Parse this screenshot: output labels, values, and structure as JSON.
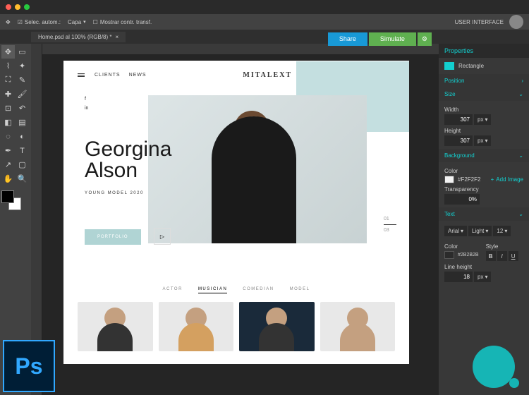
{
  "options": {
    "select_auto": "Selec. autom.:",
    "layer": "Capa",
    "show_transform": "Mostrar contr. transf.",
    "user_interface": "USER INTERFACE"
  },
  "doc": {
    "tab": "Home.psd al 100% (RGB/8) *",
    "close": "×"
  },
  "actions": {
    "share": "Share",
    "simulate": "Simulate",
    "gear": "⚙"
  },
  "site": {
    "nav": [
      "CLIENTS",
      "NEWS"
    ],
    "brand": "MITALEXT",
    "heroName1": "Georgina",
    "heroName2": "Alson",
    "subtitle": "YOUNG MODEL 2020",
    "cta": "PORTFOLIO",
    "counter": {
      "current": "01",
      "total": "03"
    },
    "categories": [
      "ACTOR",
      "MUSICIAN",
      "COMEDIAN",
      "MODEL"
    ],
    "active_cat": 1
  },
  "panel": {
    "title": "Properties",
    "shape": "Rectangle",
    "sections": {
      "position": "Position",
      "size": "Size",
      "background": "Background",
      "text": "Text"
    },
    "width_label": "Width",
    "width": "307",
    "width_unit": "px",
    "height_label": "Height",
    "height": "307",
    "height_unit": "px",
    "color_label": "Color",
    "bg_color": "#F2F2F2",
    "add_image": "Add Image",
    "transparency_label": "Transparency",
    "transparency": "0%",
    "font_family": "Arial",
    "font_weight": "Light",
    "font_size": "12",
    "text_color": "#2B2B2B",
    "style_label": "Style",
    "line_height_label": "Line height",
    "line_height": "18",
    "line_height_unit": "px"
  },
  "ps": "Ps"
}
